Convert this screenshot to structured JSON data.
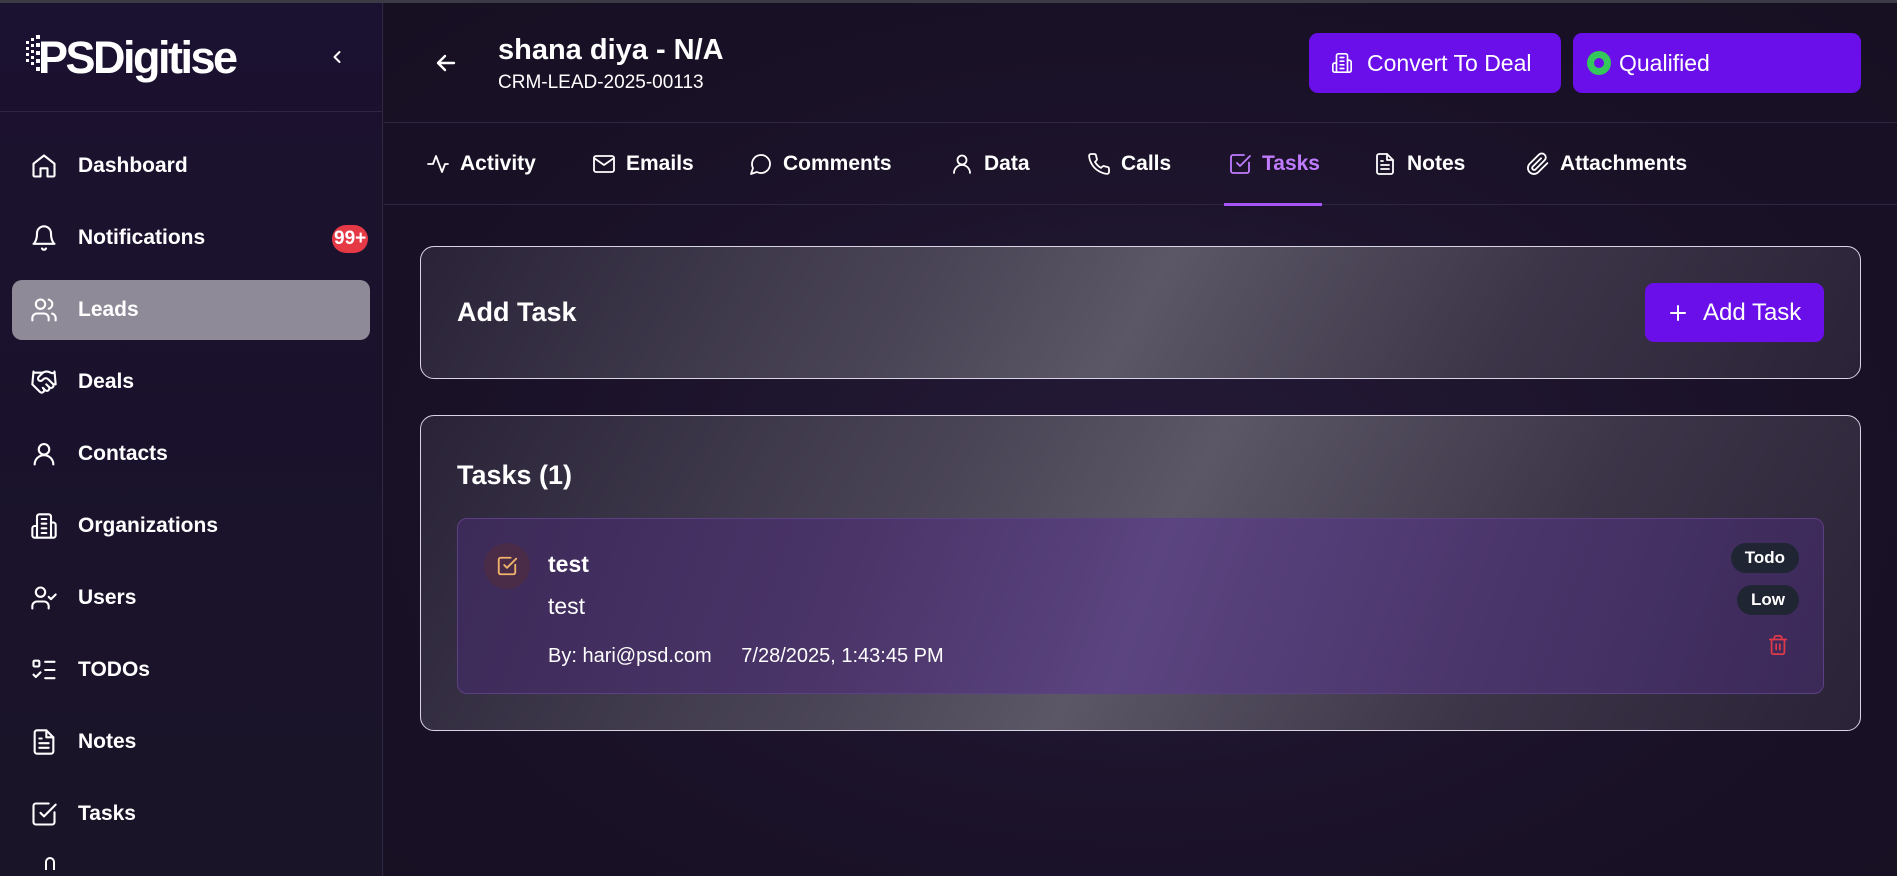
{
  "brand": {
    "logo_text": "PSDigitise",
    "accent": "#6a0fe9",
    "tab_active_color": "#c07cff",
    "badge_color": "#e53946",
    "status_color": "#34c759",
    "delete_color": "#e0394a"
  },
  "sidebar": {
    "collapse_icon": "chevron-left-icon",
    "items": [
      {
        "label": "Dashboard",
        "icon": "home-icon",
        "active": false
      },
      {
        "label": "Notifications",
        "icon": "bell-icon",
        "active": false,
        "badge": "99+"
      },
      {
        "label": "Leads",
        "icon": "users-icon",
        "active": true
      },
      {
        "label": "Deals",
        "icon": "handshake-icon",
        "active": false
      },
      {
        "label": "Contacts",
        "icon": "user-icon",
        "active": false
      },
      {
        "label": "Organizations",
        "icon": "building-icon",
        "active": false
      },
      {
        "label": "Users",
        "icon": "user-check-icon",
        "active": false
      },
      {
        "label": "TODOs",
        "icon": "list-todo-icon",
        "active": false
      },
      {
        "label": "Notes",
        "icon": "file-text-icon",
        "active": false
      },
      {
        "label": "Tasks",
        "icon": "check-square-icon",
        "active": false
      }
    ]
  },
  "header": {
    "back_icon": "arrow-left-icon",
    "title": "shana diya - N/A",
    "lead_id": "CRM-LEAD-2025-00113",
    "convert_button": "Convert To Deal",
    "status_button": "Qualified"
  },
  "tabs": [
    {
      "label": "Activity",
      "icon": "activity-icon",
      "active": false
    },
    {
      "label": "Emails",
      "icon": "mail-icon",
      "active": false
    },
    {
      "label": "Comments",
      "icon": "message-circle-icon",
      "active": false
    },
    {
      "label": "Data",
      "icon": "user-icon",
      "active": false
    },
    {
      "label": "Calls",
      "icon": "phone-icon",
      "active": false
    },
    {
      "label": "Tasks",
      "icon": "check-square-icon",
      "active": true
    },
    {
      "label": "Notes",
      "icon": "file-text-icon",
      "active": false
    },
    {
      "label": "Attachments",
      "icon": "paperclip-icon",
      "active": false
    }
  ],
  "add_task_card": {
    "title": "Add Task",
    "button": "Add Task"
  },
  "tasks_card": {
    "title": "Tasks (1)",
    "tasks": [
      {
        "title": "test",
        "description": "test",
        "by": "By: hari@psd.com",
        "timestamp": "7/28/2025, 1:43:45 PM",
        "status": "Todo",
        "priority": "Low"
      }
    ]
  }
}
